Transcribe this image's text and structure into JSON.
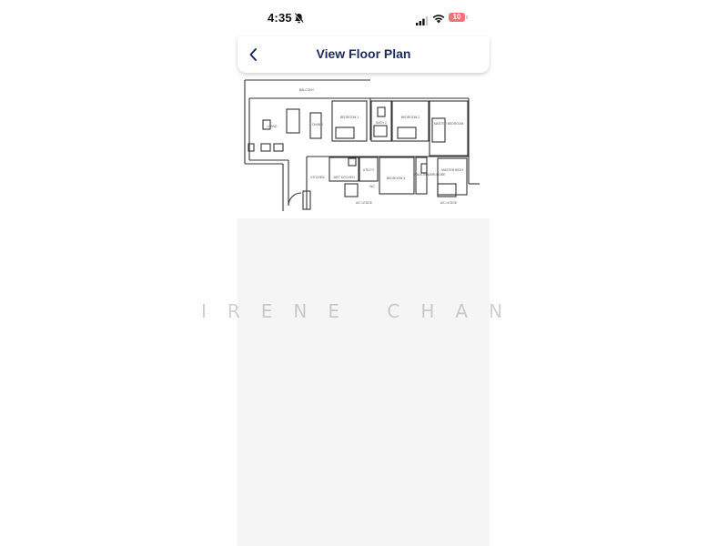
{
  "status_bar": {
    "time": "4:35",
    "battery_level": "10",
    "icons": [
      "bell-slash-icon",
      "signal-icon",
      "wifi-icon",
      "battery-icon"
    ]
  },
  "header": {
    "title": "View Floor Plan",
    "back_icon": "chevron-left-icon"
  },
  "floor_plan": {
    "rooms": {
      "balcony": "BALCONY",
      "living": "LIVING",
      "dining": "DINING",
      "bedroom_1": "BEDROOM 1",
      "bath_2": "BATH 2",
      "bedroom_2": "BEDROOM 2",
      "master_bedroom": "MASTER\nBEDROOM",
      "kitchen": "KITCHEN",
      "wet_kitchen": "WET\nKITCHEN",
      "utility": "UTILITY",
      "bedroom_3": "BEDROOM 3",
      "walk_in_wardrobe": "WALK-IN\nWARDROBE",
      "master_bath": "MASTER\nBATH",
      "ac_ledge_1": "A/C\nLEDGE",
      "ac_ledge_2": "A/C\nLEDGE",
      "wc": "WC"
    }
  },
  "watermark": "IRENE CHAN",
  "colors": {
    "title": "#1d2a5a",
    "battery": "#f0727a",
    "content_bg": "#f5f5f5"
  }
}
